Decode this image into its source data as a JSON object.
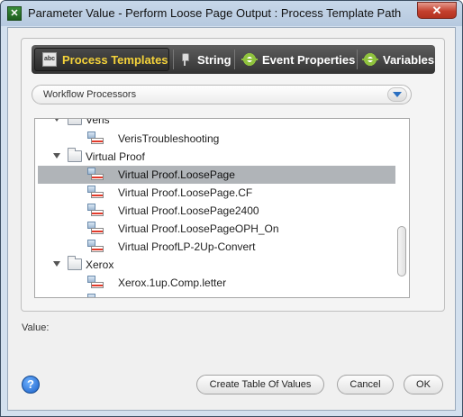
{
  "window": {
    "title": "Parameter Value - Perform Loose Page Output : Process Template Path",
    "close_glyph": "✕"
  },
  "tabs": [
    {
      "label": "Process Templates",
      "icon": "abc-icon",
      "active": true
    },
    {
      "label": "String",
      "icon": "pin-icon",
      "active": false
    },
    {
      "label": "Event Properties",
      "icon": "gear-icon",
      "active": false
    },
    {
      "label": "Variables",
      "icon": "gear-icon",
      "active": false
    }
  ],
  "dropdown": {
    "selected": "Workflow Processors"
  },
  "tree": {
    "rows": [
      {
        "label": "Veris",
        "type": "folder",
        "level": 0,
        "expanded": true
      },
      {
        "label": "VerisTroubleshooting",
        "type": "process",
        "level": 1
      },
      {
        "label": "Virtual Proof",
        "type": "folder",
        "level": 0,
        "expanded": true
      },
      {
        "label": "Virtual Proof.LoosePage",
        "type": "process",
        "level": 1,
        "selected": true
      },
      {
        "label": "Virtual Proof.LoosePage.CF",
        "type": "process",
        "level": 1
      },
      {
        "label": "Virtual Proof.LoosePage2400",
        "type": "process",
        "level": 1
      },
      {
        "label": "Virtual Proof.LoosePageOPH_On",
        "type": "process",
        "level": 1
      },
      {
        "label": "Virtual ProofLP-2Up-Convert",
        "type": "process",
        "level": 1
      },
      {
        "label": "Xerox",
        "type": "folder",
        "level": 0,
        "expanded": true
      },
      {
        "label": "Xerox.1up.Comp.letter",
        "type": "process",
        "level": 1
      }
    ]
  },
  "value_label": "Value:",
  "buttons": {
    "help": "?",
    "create_table": "Create Table Of Values",
    "cancel": "Cancel",
    "ok": "OK"
  }
}
